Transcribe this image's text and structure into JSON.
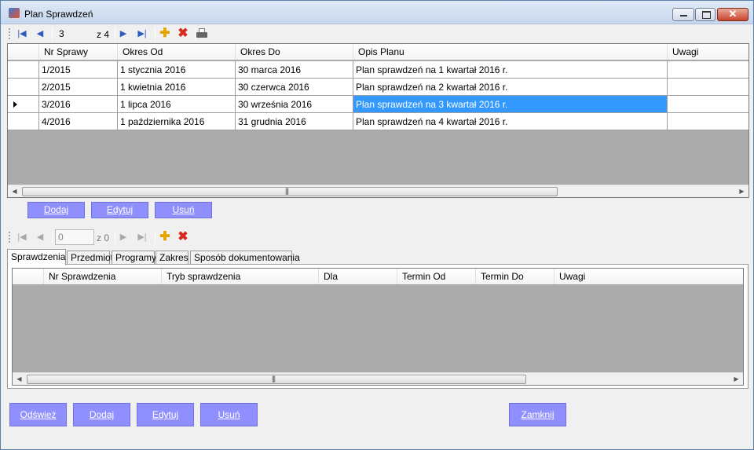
{
  "window": {
    "title": "Plan Sprawdzeń"
  },
  "nav1": {
    "position": "3",
    "count": "z 4"
  },
  "nav2": {
    "position": "0",
    "count": "z 0"
  },
  "grid1": {
    "columns": [
      "Nr Sprawy",
      "Okres Od",
      "Okres Do",
      "Opis Planu",
      "Uwagi"
    ],
    "rows": [
      [
        "1/2015",
        "1 stycznia 2016",
        "30 marca 2016",
        "Plan sprawdzeń na 1 kwartał 2016 r.",
        ""
      ],
      [
        "2/2015",
        "1 kwietnia 2016",
        "30 czerwca 2016",
        "Plan sprawdzeń na 2 kwartał 2016 r.",
        ""
      ],
      [
        "3/2016",
        "1 lipca 2016",
        "30 września 2016",
        "Plan sprawdzeń na 3 kwartał 2016 r.",
        ""
      ],
      [
        "4/2016",
        "1 października 2016",
        "31 grudnia 2016",
        "Plan sprawdzeń na 4 kwartał 2016 r.",
        ""
      ]
    ],
    "selected_row_index": 2
  },
  "grid1_buttons": {
    "add": "Dodaj",
    "edit": "Edytuj",
    "delete": "Usuń"
  },
  "tabs": [
    "Sprawdzenia",
    "Przedmiot",
    "Programy",
    "Zakres",
    "Sposób dokumentowania"
  ],
  "grid2": {
    "columns": [
      "Nr Sprawdzenia",
      "Tryb sprawdzenia",
      "Dla",
      "Termin Od",
      "Termin Do",
      "Uwagi"
    ]
  },
  "footer": {
    "refresh": "Odśwież",
    "add": "Dodaj",
    "edit": "Edytuj",
    "delete": "Usuń",
    "close": "Zamknij"
  },
  "colors": {
    "button": "#8f8fff",
    "selection": "#3399ff",
    "grid_background": "#ababab"
  }
}
